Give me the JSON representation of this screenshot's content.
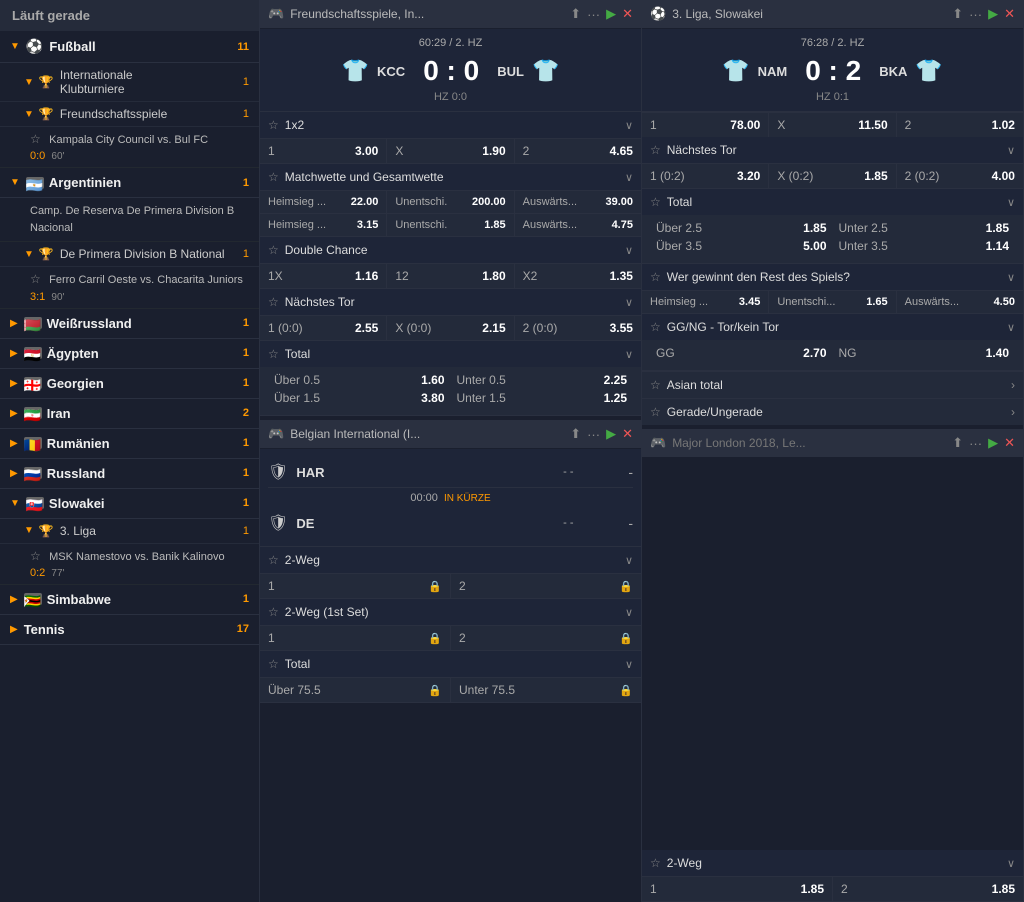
{
  "sidebar": {
    "header": "Läuft gerade",
    "sections": [
      {
        "type": "main",
        "label": "Fußball",
        "count": "11",
        "expanded": true,
        "icon": "⚽",
        "children": [
          {
            "type": "subsection",
            "label": "Internationale Klubturniere",
            "count": "1",
            "icon": "🏆",
            "expanded": true,
            "children": []
          },
          {
            "type": "subsection",
            "label": "Freundschaftsspiele",
            "count": "1",
            "icon": "🏆",
            "expanded": true,
            "children": [
              {
                "name": "Kampala City Council vs. Bul FC",
                "score": "0:0",
                "time": "60'"
              }
            ]
          },
          {
            "type": "country",
            "label": "Argentinien",
            "count": "1",
            "flag": "🇦🇷",
            "expanded": true,
            "children": [
              {
                "name": "Camp. De Reserva De Primera Division B Nacional",
                "score": "",
                "time": ""
              },
              {
                "name": "Ferro Carril Oeste vs. Chacarita Juniors",
                "score": "3:1",
                "time": "90'"
              }
            ]
          },
          {
            "type": "country",
            "label": "Weißrussland",
            "count": "1",
            "flag": "🇧🇾",
            "expanded": false
          },
          {
            "type": "country",
            "label": "Ägypten",
            "count": "1",
            "flag": "🇪🇬",
            "expanded": false
          },
          {
            "type": "country",
            "label": "Georgien",
            "count": "1",
            "flag": "🇬🇪",
            "expanded": false
          },
          {
            "type": "country",
            "label": "Iran",
            "count": "2",
            "flag": "🇮🇷",
            "expanded": false
          },
          {
            "type": "country",
            "label": "Rumänien",
            "count": "1",
            "flag": "🇷🇴",
            "expanded": false
          },
          {
            "type": "country",
            "label": "Russland",
            "count": "1",
            "flag": "🇷🇺",
            "expanded": false
          },
          {
            "type": "country",
            "label": "Slowakei",
            "count": "1",
            "flag": "🇸🇰",
            "expanded": true,
            "children": [
              {
                "type": "subsection",
                "label": "3. Liga",
                "count": "1",
                "icon": "🏆",
                "expanded": true
              },
              {
                "name": "MSK Namestovo vs. Banik Kalinovo",
                "score": "0:2",
                "time": "77'"
              }
            ]
          },
          {
            "type": "country",
            "label": "Simbabwe",
            "count": "1",
            "flag": "🇿🇼",
            "expanded": false
          },
          {
            "type": "country",
            "label": "Tennis",
            "count": "17",
            "flag": "",
            "expanded": false,
            "isCategory": true
          }
        ]
      }
    ]
  },
  "panels": [
    {
      "id": "panel1",
      "header": {
        "icon": "🎮",
        "title": "Freundschaftsspiele, In...",
        "actions": [
          "upload",
          "more",
          "play",
          "close"
        ]
      },
      "matchBlock": {
        "time": "60:29 / 2. HZ",
        "team1": {
          "name": "KCC",
          "shirt": "👕"
        },
        "team2": {
          "name": "BUL",
          "shirt": "👕"
        },
        "score": "0 : 0",
        "halftime": "HZ 0:0"
      },
      "sections": [
        {
          "id": "1x2",
          "label": "1x2",
          "type": "simple-odds",
          "odds": [
            {
              "label": "1",
              "value": "3.00"
            },
            {
              "label": "X",
              "value": "1.90"
            },
            {
              "label": "2",
              "value": "4.65"
            }
          ]
        },
        {
          "id": "matchwette",
          "label": "Matchwette und Gesamtwette",
          "type": "double-grid",
          "rows": [
            [
              {
                "label": "Heimsieg ...",
                "value": "22.00"
              },
              {
                "label": "Unentschi.",
                "value": "200.00"
              },
              {
                "label": "Auswärts...",
                "value": "39.00"
              }
            ],
            [
              {
                "label": "Heimsieg ...",
                "value": "3.15"
              },
              {
                "label": "Unentschi.",
                "value": "1.85"
              },
              {
                "label": "Auswärts...",
                "value": "4.75"
              }
            ]
          ]
        },
        {
          "id": "double-chance",
          "label": "Double Chance",
          "type": "simple-odds",
          "odds": [
            {
              "label": "1X",
              "value": "1.16"
            },
            {
              "label": "12",
              "value": "1.80"
            },
            {
              "label": "X2",
              "value": "1.35"
            }
          ]
        },
        {
          "id": "naechstes-tor",
          "label": "Nächstes Tor",
          "type": "simple-odds",
          "odds": [
            {
              "label": "1 (0:0)",
              "value": "2.55"
            },
            {
              "label": "X (0:0)",
              "value": "2.15"
            },
            {
              "label": "2 (0:0)",
              "value": "3.55"
            }
          ]
        },
        {
          "id": "total",
          "label": "Total",
          "type": "total-grid",
          "rows": [
            {
              "over_label": "Über 0.5",
              "over_val": "1.60",
              "under_label": "Unter 0.5",
              "under_val": "2.25"
            },
            {
              "over_label": "Über 1.5",
              "over_val": "3.80",
              "under_label": "Unter 1.5",
              "under_val": "1.25"
            }
          ]
        }
      ],
      "panel2Header": {
        "icon": "🎮",
        "title": "Belgian International (I...",
        "actions": [
          "upload",
          "more",
          "play",
          "close"
        ]
      },
      "panel2MatchBlock": {
        "team1": {
          "name": "HAR",
          "shield": "🛡"
        },
        "team2": {
          "name": "DE",
          "shield": "🛡"
        },
        "score1": "- -",
        "score2": "- -",
        "timeInfo": "00:00",
        "timeLabel": "IN KÜRZE"
      },
      "panel2Sections": [
        {
          "id": "2-weg",
          "label": "2-Weg",
          "type": "two-way-lock",
          "odds": [
            {
              "label": "1",
              "locked": true
            },
            {
              "label": "2",
              "locked": true
            }
          ]
        },
        {
          "id": "2-weg-1st-set",
          "label": "2-Weg (1st Set)",
          "type": "two-way-lock",
          "odds": [
            {
              "label": "1",
              "locked": true
            },
            {
              "label": "2",
              "locked": true
            }
          ]
        },
        {
          "id": "total2",
          "label": "Total",
          "type": "total-under-lock",
          "rows": [
            {
              "over_label": "Über 75.5",
              "over_locked": true,
              "under_label": "Unter 75.5",
              "under_locked": true
            }
          ]
        }
      ]
    },
    {
      "id": "panel2",
      "header": {
        "icon": "⚽",
        "title": "3. Liga, Slowakei",
        "actions": [
          "upload",
          "more",
          "play",
          "close"
        ]
      },
      "matchBlock": {
        "time": "76:28 / 2. HZ",
        "team1": {
          "name": "NAM",
          "shirt": "👕"
        },
        "team2": {
          "name": "BKA",
          "shirt": "👕"
        },
        "score": "0 : 2",
        "halftime": "HZ 0:1"
      },
      "topOddsRow": {
        "v1": "1",
        "odds1": "78.00",
        "labelX": "X",
        "oddsX": "11.50",
        "v2": "2",
        "odds2": "1.02"
      },
      "sections": [
        {
          "id": "naechstes-tor-r",
          "label": "Nächstes Tor",
          "type": "simple-odds",
          "odds": [
            {
              "label": "1 (0:2)",
              "value": "3.20"
            },
            {
              "label": "X (0:2)",
              "value": "1.85"
            },
            {
              "label": "2 (0:2)",
              "value": "4.00"
            }
          ]
        },
        {
          "id": "total-r",
          "label": "Total",
          "type": "total-grid",
          "rows": [
            {
              "over_label": "Über 2.5",
              "over_val": "1.85",
              "under_label": "Unter 2.5",
              "under_val": "1.85"
            },
            {
              "over_label": "Über 3.5",
              "over_val": "5.00",
              "under_label": "Unter 3.5",
              "under_val": "1.14"
            }
          ]
        },
        {
          "id": "wer-gewinnt",
          "label": "Wer gewinnt den Rest des Spiels?",
          "type": "simple-odds",
          "odds": [
            {
              "label": "Heimsieg ...",
              "value": "3.45"
            },
            {
              "label": "Unentschi...",
              "value": "1.65"
            },
            {
              "label": "Auswärts...",
              "value": "4.50"
            }
          ]
        },
        {
          "id": "gg-ng",
          "label": "GG/NG - Tor/kein Tor",
          "type": "two-col",
          "odds": [
            {
              "label": "GG",
              "value": "2.70"
            },
            {
              "label": "NG",
              "value": "1.40"
            }
          ]
        },
        {
          "id": "asian-total",
          "label": "Asian total",
          "type": "arrow-only"
        },
        {
          "id": "gerade-ungerade",
          "label": "Gerade/Ungerade",
          "type": "arrow-only"
        }
      ],
      "panel2Header": {
        "icon": "🎮",
        "title": "Major London 2018, Le...",
        "actions": [
          "upload",
          "more",
          "play",
          "close"
        ]
      },
      "panel2Section": {
        "label": "2-Weg",
        "odds": [
          {
            "label": "1",
            "value": "1.85"
          },
          {
            "label": "2",
            "value": "1.85"
          }
        ]
      }
    }
  ]
}
